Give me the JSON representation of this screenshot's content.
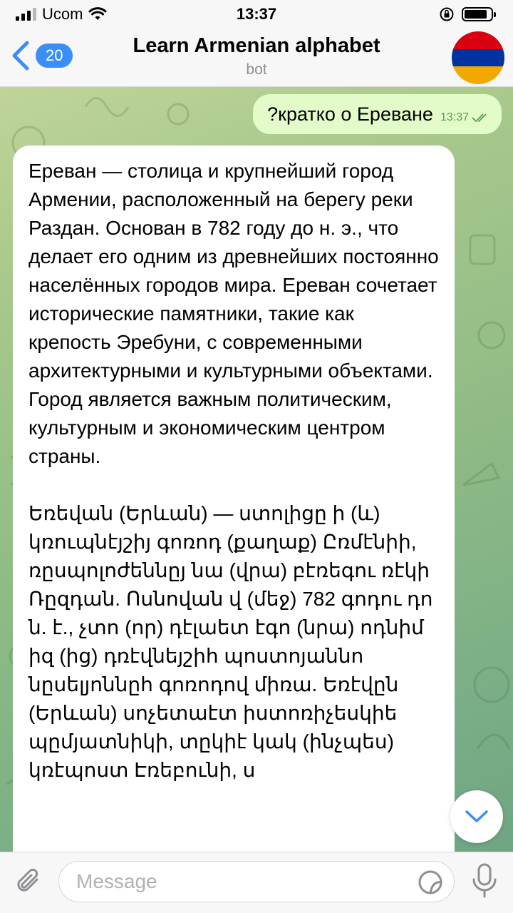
{
  "status_bar": {
    "carrier": "Ucom",
    "time": "13:37",
    "battery_level": 0.85,
    "signal_bars": 3
  },
  "header": {
    "back_badge": "20",
    "title": "Learn Armenian alphabet",
    "subtitle": "bot",
    "avatar": "armenian-flag",
    "flag_colors": [
      "#d90012",
      "#0033a0",
      "#f2a800"
    ]
  },
  "messages": {
    "outgoing": {
      "text": "?кратко о Ереване",
      "time": "13:37",
      "status_icon": "double-check-icon"
    },
    "incoming": {
      "paragraphs": [
        "Ереван — столица и крупнейший город Армении, расположенный на берегу реки Раздан. Основан в 782 году до н. э., что делает его одним из древнейших постоянно населённых городов мира. Ереван сочетает исторические памятники, такие как крепость Эребуни, с современными архитектурными и культурными объектами. Город является важным политическим, культурным и экономическим центром страны.",
        "Եռեվան (Երևան) — ստոլիցը ի (և) կռուպնէյշիյ գոռոդ (քաղաք) Ըռմէնիի, ռըսպոլոժեննըյ նա (վրա) բէռեգու ռէկի Ռըզդան. Ոսնովան վ (մեջ) 782 գոդու դո ն. է., չտո (որ) դէլաետ էգո (նրա) ոդնիմ իզ (ից) դռէվնեյշիհ պոստոյաննո նըսելյոննըհ գոռոդով միռա. Եռէվըն (Երևան) սոչետաէտ իստոռիչեսկիե պըմյատնիկի, տըկիէ կակ (ինչպես) կռէպոստ Էռեբունի, ս"
      ]
    }
  },
  "composer": {
    "placeholder": "Message"
  },
  "colors": {
    "accent": "#3b8ef5",
    "outgoing_bubble": "#e3fbc9",
    "incoming_bubble": "#ffffff"
  }
}
